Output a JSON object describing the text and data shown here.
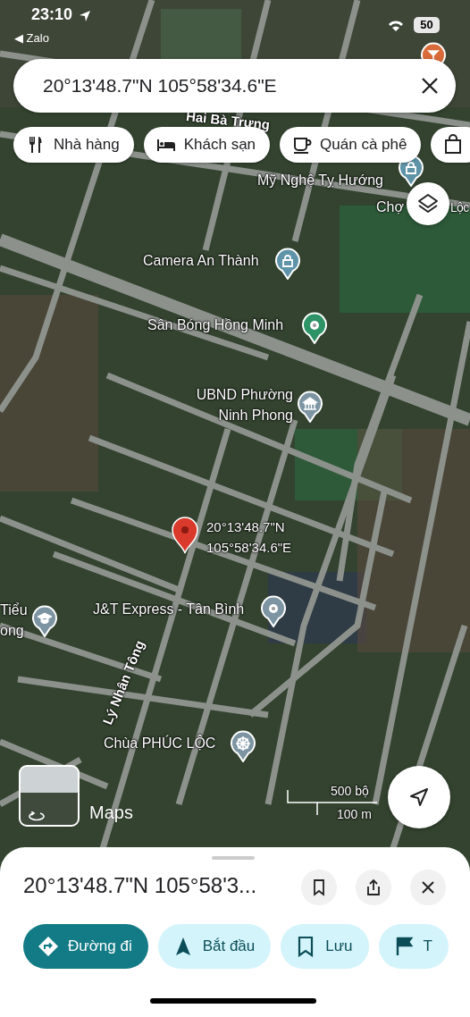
{
  "status_bar": {
    "time": "23:10",
    "back_app": "◀ Zalo",
    "battery": "50"
  },
  "search": {
    "value": "20°13'48.7\"N 105°58'34.6\"E"
  },
  "chips": [
    {
      "label": "Nhà hàng"
    },
    {
      "label": "Khách sạn"
    },
    {
      "label": "Quán cà phê"
    }
  ],
  "chips_overflow": true,
  "streets": [
    "Hai Bà Trưng",
    "Lý Nhân Tông"
  ],
  "places": [
    {
      "lines": [
        "Mỹ Nghệ Tỵ Hướng"
      ],
      "color": "#5e93a8"
    },
    {
      "lines": [
        "Chợ"
      ]
    },
    {
      "lines": [
        "Lộc"
      ]
    },
    {
      "lines": [
        "Camera An Thành"
      ],
      "color": "#5e93a8"
    },
    {
      "lines": [
        "Sân Bóng Hồng Minh"
      ],
      "color": "#2e9467"
    },
    {
      "lines": [
        "UBND Phường",
        "Ninh Phong"
      ],
      "color": "#7d95a3"
    },
    {
      "lines": [
        "Tiểu",
        "ong"
      ],
      "color": "#7d95a3"
    },
    {
      "lines": [
        "J&T Express - Tân Bình"
      ],
      "color": "#7d95a3"
    },
    {
      "lines": [
        "Chùa PHÚC LỘC"
      ],
      "color": "#7d95a3"
    }
  ],
  "dropped_pin": {
    "lines": [
      "20°13'48.7\"N",
      "105°58'34.6\"E"
    ]
  },
  "logo": "Maps",
  "scale": {
    "imperial": "500 bộ",
    "metric": "100 m"
  },
  "sheet": {
    "title": "20°13'48.7\"N 105°58'3...",
    "actions": [
      {
        "label": "Đường đi",
        "kind": "primary"
      },
      {
        "label": "Bắt đầu",
        "kind": "secondary"
      },
      {
        "label": "Lưu",
        "kind": "secondary"
      },
      {
        "label": "T",
        "kind": "secondary"
      }
    ]
  }
}
